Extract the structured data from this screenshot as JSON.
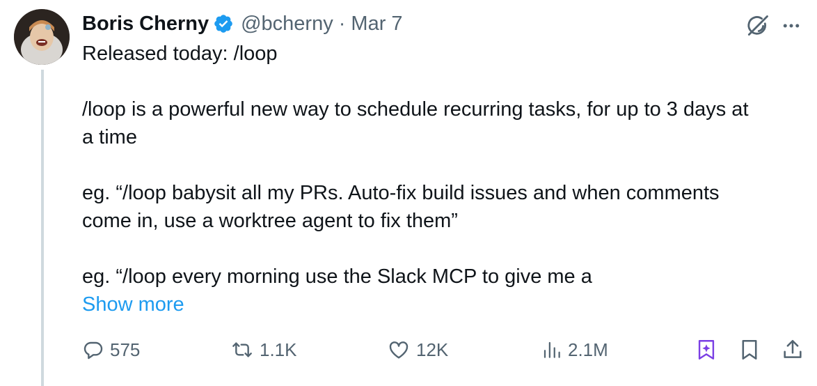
{
  "author": {
    "display_name": "Boris Cherny",
    "handle": "@bcherny",
    "date": "Mar 7",
    "separator": "·",
    "verified": true
  },
  "tweet": {
    "line1": "Released today: /loop",
    "para2": "/loop is a powerful new way to schedule recurring tasks, for up to 3 days at\na time",
    "para3": "eg. “/loop babysit all my PRs. Auto-fix build issues and when comments\ncome in, use a worktree agent to fix them”",
    "para4": "eg. “/loop every morning use the Slack MCP to give me a",
    "show_more": "Show more"
  },
  "actions": {
    "replies": "575",
    "reposts": "1.1K",
    "likes": "12K",
    "views": "2.1M"
  },
  "colors": {
    "text": "#0f1419",
    "secondary": "#536471",
    "link": "#1d9bf0",
    "verified": "#1d9bf0",
    "grok_bookmark": "#7b3fe4",
    "thread_line": "#cfd9de"
  },
  "icons": {
    "verified": "verified-badge-icon",
    "grok": "grok-icon",
    "more": "more-icon",
    "reply": "reply-icon",
    "repost": "repost-icon",
    "like": "heart-icon",
    "views": "views-icon",
    "grok_bookmark": "grok-bookmark-icon",
    "bookmark": "bookmark-icon",
    "share": "share-icon"
  }
}
